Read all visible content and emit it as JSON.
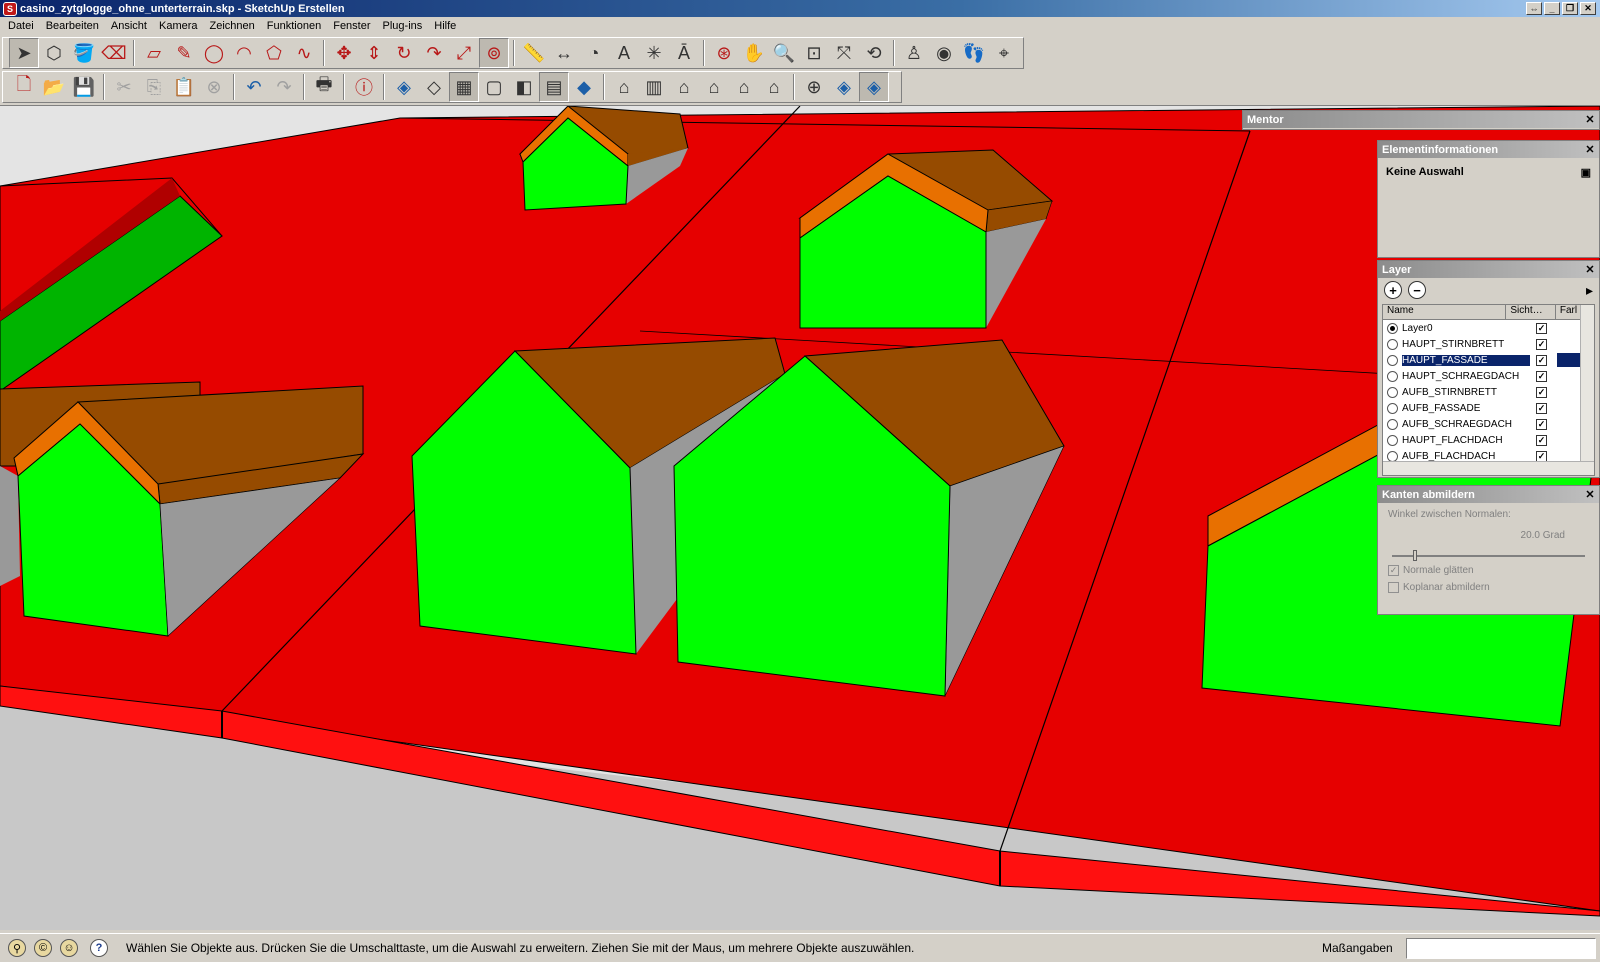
{
  "window": {
    "title": "casino_zytglogge_ohne_unterterrain.skp - SketchUp Erstellen",
    "app_icon": "sketchup-logo-icon"
  },
  "menu": [
    "Datei",
    "Bearbeiten",
    "Ansicht",
    "Kamera",
    "Zeichnen",
    "Funktionen",
    "Fenster",
    "Plug-ins",
    "Hilfe"
  ],
  "toolbar1": {
    "icons": [
      "select-arrow-icon",
      "make-component-icon",
      "paint-bucket-icon",
      "eraser-icon",
      "rectangle-icon",
      "pencil-line-icon",
      "circle-icon",
      "arc-icon",
      "polygon-icon",
      "freehand-icon",
      "move-icon",
      "push-pull-icon",
      "rotate-icon",
      "follow-me-icon",
      "scale-icon",
      "offset-icon",
      "tape-measure-icon",
      "dimension-icon",
      "protractor-icon",
      "text-icon",
      "axes-icon",
      "3d-text-icon",
      "orbit-icon",
      "pan-icon",
      "zoom-icon",
      "zoom-window-icon",
      "zoom-extents-icon",
      "previous-view-icon",
      "position-camera-icon",
      "look-around-icon",
      "walk-icon",
      "section-plane-icon"
    ]
  },
  "toolbar2": {
    "icons": [
      "new-file-icon",
      "open-file-icon",
      "save-icon",
      "cut-icon",
      "copy-icon",
      "paste-icon",
      "delete-icon",
      "undo-icon",
      "redo-icon",
      "print-icon",
      "model-info-icon",
      "xray-icon",
      "back-edges-icon",
      "wireframe-icon",
      "hidden-line-icon",
      "shaded-icon",
      "shaded-textures-icon",
      "monochrome-icon",
      "iso-view-icon",
      "top-view-icon",
      "front-view-icon",
      "right-view-icon",
      "back-view-icon",
      "left-view-icon",
      "section-display-icon",
      "section-cuts-icon",
      "section-fill-icon"
    ]
  },
  "panels": {
    "mentor": {
      "title": "Mentor"
    },
    "entity_info": {
      "title": "Elementinformationen",
      "content": "Keine Auswahl"
    },
    "layer": {
      "title": "Layer",
      "columns": [
        "Name",
        "Sicht…",
        "Farl"
      ],
      "rows": [
        {
          "name": "Layer0",
          "active": true,
          "visible": true,
          "color": "#ffffff"
        },
        {
          "name": "HAUPT_STIRNBRETT",
          "active": false,
          "visible": true,
          "color": "#ffffff"
        },
        {
          "name": "HAUPT_FASSADE",
          "active": false,
          "visible": true,
          "color": "#0a246a",
          "selected": true
        },
        {
          "name": "HAUPT_SCHRAEGDACH",
          "active": false,
          "visible": true,
          "color": "#ffffff"
        },
        {
          "name": "AUFB_STIRNBRETT",
          "active": false,
          "visible": true,
          "color": "#ffffff"
        },
        {
          "name": "AUFB_FASSADE",
          "active": false,
          "visible": true,
          "color": "#ffffff"
        },
        {
          "name": "AUFB_SCHRAEGDACH",
          "active": false,
          "visible": true,
          "color": "#ffffff"
        },
        {
          "name": "HAUPT_FLACHDACH",
          "active": false,
          "visible": true,
          "color": "#ffffff"
        },
        {
          "name": "AUFB_FLACHDACH",
          "active": false,
          "visible": true,
          "color": "#ffffff"
        }
      ]
    },
    "soft_edges": {
      "title": "Kanten abmildern",
      "angle_label": "Winkel zwischen Normalen:",
      "angle_value": "20.0",
      "angle_unit": "Grad",
      "angle_fraction": 0.11,
      "smooth_normals_label": "Normale glätten",
      "smooth_normals": true,
      "soften_coplanar_label": "Koplanar abmildern",
      "soften_coplanar": false
    }
  },
  "status": {
    "message": "Wählen Sie Objekte aus. Drücken Sie die Umschalttaste, um die Auswahl zu erweitern. Ziehen Sie mit der Maus, um mehrere Objekte auszuwählen.",
    "measurements_label": "Maßangaben",
    "measurements_value": ""
  },
  "colors": {
    "terrain_red": "#e60000",
    "facade_green": "#00ff00",
    "roof_brown": "#964b00",
    "fascia_orange": "#e87000",
    "wall_gray": "#999999",
    "sky_gray": "#e4e4e4"
  }
}
